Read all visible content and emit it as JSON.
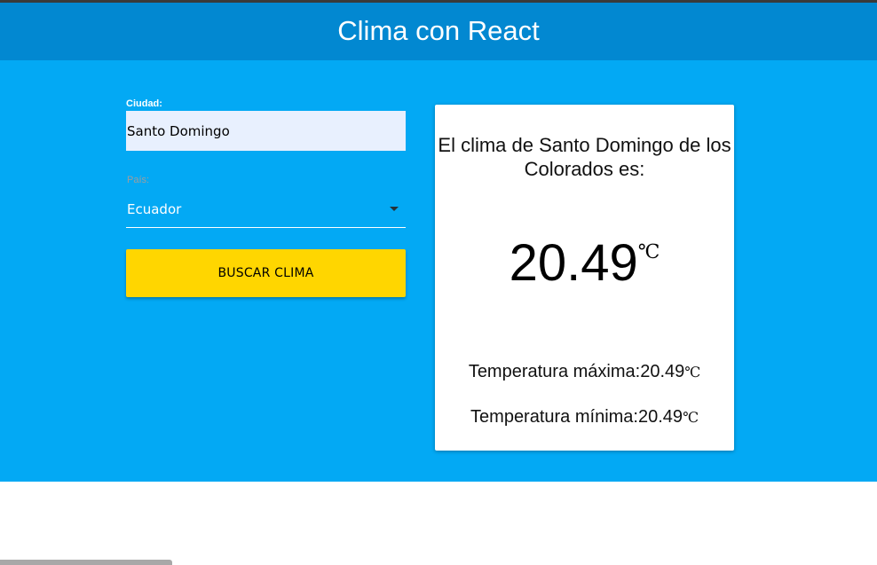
{
  "header": {
    "title": "Clima con React"
  },
  "form": {
    "city_label": "Ciudad:",
    "city_value": "Santo Domingo",
    "country_label": "País:",
    "country_value": "Ecuador",
    "search_button_label": "BUSCAR CLIMA"
  },
  "result": {
    "title": "El clima de Santo Domingo de los Colorados es:",
    "temperature": "20.49",
    "unit": "℃",
    "max_label": "Temperatura máxima:",
    "max_value": "20.49",
    "min_label": "Temperatura mínima:",
    "min_value": "20.49"
  },
  "colors": {
    "header_bg": "#0288d1",
    "main_bg": "#03a9f4",
    "button_bg": "#ffd600",
    "input_bg": "#e8f0fe",
    "card_bg": "#ffffff"
  },
  "icons": {
    "select_caret": "caret-down-icon"
  }
}
